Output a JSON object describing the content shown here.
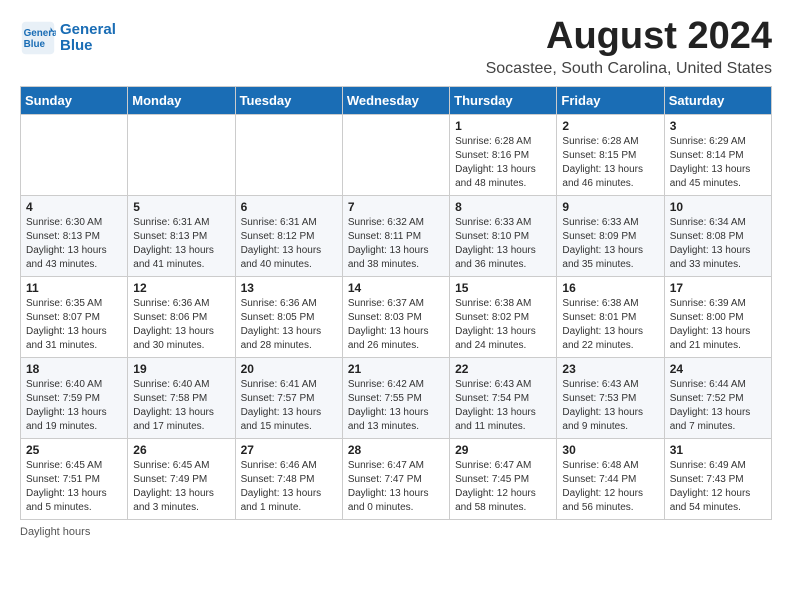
{
  "header": {
    "logo_line1": "General",
    "logo_line2": "Blue",
    "title": "August 2024",
    "subtitle": "Socastee, South Carolina, United States"
  },
  "days_of_week": [
    "Sunday",
    "Monday",
    "Tuesday",
    "Wednesday",
    "Thursday",
    "Friday",
    "Saturday"
  ],
  "weeks": [
    [
      {
        "day": "",
        "sunrise": "",
        "sunset": "",
        "daylight": ""
      },
      {
        "day": "",
        "sunrise": "",
        "sunset": "",
        "daylight": ""
      },
      {
        "day": "",
        "sunrise": "",
        "sunset": "",
        "daylight": ""
      },
      {
        "day": "",
        "sunrise": "",
        "sunset": "",
        "daylight": ""
      },
      {
        "day": "1",
        "sunrise": "6:28 AM",
        "sunset": "8:16 PM",
        "daylight": "13 hours and 48 minutes."
      },
      {
        "day": "2",
        "sunrise": "6:28 AM",
        "sunset": "8:15 PM",
        "daylight": "13 hours and 46 minutes."
      },
      {
        "day": "3",
        "sunrise": "6:29 AM",
        "sunset": "8:14 PM",
        "daylight": "13 hours and 45 minutes."
      }
    ],
    [
      {
        "day": "4",
        "sunrise": "6:30 AM",
        "sunset": "8:13 PM",
        "daylight": "13 hours and 43 minutes."
      },
      {
        "day": "5",
        "sunrise": "6:31 AM",
        "sunset": "8:13 PM",
        "daylight": "13 hours and 41 minutes."
      },
      {
        "day": "6",
        "sunrise": "6:31 AM",
        "sunset": "8:12 PM",
        "daylight": "13 hours and 40 minutes."
      },
      {
        "day": "7",
        "sunrise": "6:32 AM",
        "sunset": "8:11 PM",
        "daylight": "13 hours and 38 minutes."
      },
      {
        "day": "8",
        "sunrise": "6:33 AM",
        "sunset": "8:10 PM",
        "daylight": "13 hours and 36 minutes."
      },
      {
        "day": "9",
        "sunrise": "6:33 AM",
        "sunset": "8:09 PM",
        "daylight": "13 hours and 35 minutes."
      },
      {
        "day": "10",
        "sunrise": "6:34 AM",
        "sunset": "8:08 PM",
        "daylight": "13 hours and 33 minutes."
      }
    ],
    [
      {
        "day": "11",
        "sunrise": "6:35 AM",
        "sunset": "8:07 PM",
        "daylight": "13 hours and 31 minutes."
      },
      {
        "day": "12",
        "sunrise": "6:36 AM",
        "sunset": "8:06 PM",
        "daylight": "13 hours and 30 minutes."
      },
      {
        "day": "13",
        "sunrise": "6:36 AM",
        "sunset": "8:05 PM",
        "daylight": "13 hours and 28 minutes."
      },
      {
        "day": "14",
        "sunrise": "6:37 AM",
        "sunset": "8:03 PM",
        "daylight": "13 hours and 26 minutes."
      },
      {
        "day": "15",
        "sunrise": "6:38 AM",
        "sunset": "8:02 PM",
        "daylight": "13 hours and 24 minutes."
      },
      {
        "day": "16",
        "sunrise": "6:38 AM",
        "sunset": "8:01 PM",
        "daylight": "13 hours and 22 minutes."
      },
      {
        "day": "17",
        "sunrise": "6:39 AM",
        "sunset": "8:00 PM",
        "daylight": "13 hours and 21 minutes."
      }
    ],
    [
      {
        "day": "18",
        "sunrise": "6:40 AM",
        "sunset": "7:59 PM",
        "daylight": "13 hours and 19 minutes."
      },
      {
        "day": "19",
        "sunrise": "6:40 AM",
        "sunset": "7:58 PM",
        "daylight": "13 hours and 17 minutes."
      },
      {
        "day": "20",
        "sunrise": "6:41 AM",
        "sunset": "7:57 PM",
        "daylight": "13 hours and 15 minutes."
      },
      {
        "day": "21",
        "sunrise": "6:42 AM",
        "sunset": "7:55 PM",
        "daylight": "13 hours and 13 minutes."
      },
      {
        "day": "22",
        "sunrise": "6:43 AM",
        "sunset": "7:54 PM",
        "daylight": "13 hours and 11 minutes."
      },
      {
        "day": "23",
        "sunrise": "6:43 AM",
        "sunset": "7:53 PM",
        "daylight": "13 hours and 9 minutes."
      },
      {
        "day": "24",
        "sunrise": "6:44 AM",
        "sunset": "7:52 PM",
        "daylight": "13 hours and 7 minutes."
      }
    ],
    [
      {
        "day": "25",
        "sunrise": "6:45 AM",
        "sunset": "7:51 PM",
        "daylight": "13 hours and 5 minutes."
      },
      {
        "day": "26",
        "sunrise": "6:45 AM",
        "sunset": "7:49 PM",
        "daylight": "13 hours and 3 minutes."
      },
      {
        "day": "27",
        "sunrise": "6:46 AM",
        "sunset": "7:48 PM",
        "daylight": "13 hours and 1 minute."
      },
      {
        "day": "28",
        "sunrise": "6:47 AM",
        "sunset": "7:47 PM",
        "daylight": "13 hours and 0 minutes."
      },
      {
        "day": "29",
        "sunrise": "6:47 AM",
        "sunset": "7:45 PM",
        "daylight": "12 hours and 58 minutes."
      },
      {
        "day": "30",
        "sunrise": "6:48 AM",
        "sunset": "7:44 PM",
        "daylight": "12 hours and 56 minutes."
      },
      {
        "day": "31",
        "sunrise": "6:49 AM",
        "sunset": "7:43 PM",
        "daylight": "12 hours and 54 minutes."
      }
    ]
  ],
  "footer": {
    "note": "Daylight hours"
  }
}
